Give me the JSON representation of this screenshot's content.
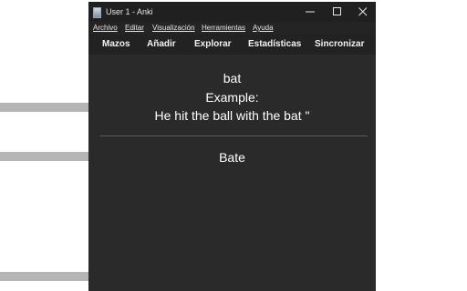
{
  "window": {
    "title": "User 1 - Anki",
    "icon": "anki-app-icon",
    "controls": [
      "minimize-icon",
      "maximize-icon",
      "close-icon"
    ]
  },
  "menubar": {
    "items": [
      "Archivo",
      "Editar",
      "Visualización",
      "Herramientas",
      "Ayuda"
    ]
  },
  "toolbar": {
    "items": [
      "Mazos",
      "Añadir",
      "Explorar",
      "Estadísticas",
      "Sincronizar"
    ]
  },
  "card": {
    "front_word": "bat",
    "example_label": "Example:",
    "example_sentence": "He hit the ball with the bat \"",
    "back_translation": "Bate"
  },
  "colors": {
    "window_background": "#2a2a2a",
    "titlebar": "#202020",
    "text": "#ffffff"
  }
}
